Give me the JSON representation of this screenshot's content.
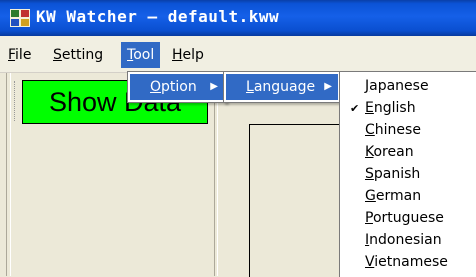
{
  "window": {
    "title": "KW Watcher – default.kww",
    "icon": "app-icon"
  },
  "menubar": {
    "items": [
      {
        "key": "F",
        "rest": "ile"
      },
      {
        "key": "S",
        "rest": "etting"
      },
      {
        "key": "T",
        "rest": "ool"
      },
      {
        "key": "H",
        "rest": "elp"
      }
    ]
  },
  "toolbar": {
    "show_data_label": "Show Data",
    "show_data_color": "#00ff00"
  },
  "tool_menu": {
    "option": {
      "key": "O",
      "rest": "ption"
    }
  },
  "option_menu": {
    "language": {
      "key": "L",
      "rest": "anguage"
    }
  },
  "language_menu": {
    "selected": "English",
    "items": [
      {
        "key": "J",
        "rest": "apanese"
      },
      {
        "key": "E",
        "rest": "nglish",
        "checked": true
      },
      {
        "key": "C",
        "rest": "hinese"
      },
      {
        "key": "K",
        "rest": "orean"
      },
      {
        "key": "S",
        "rest": "panish"
      },
      {
        "key": "G",
        "rest": "erman"
      },
      {
        "key": "P",
        "rest": "ortuguese"
      },
      {
        "key": "I",
        "rest": "ndonesian"
      },
      {
        "key": "V",
        "rest": "ietnamese"
      }
    ]
  },
  "colors": {
    "highlight": "#316ac5",
    "titlebar": "#0b53d6"
  }
}
